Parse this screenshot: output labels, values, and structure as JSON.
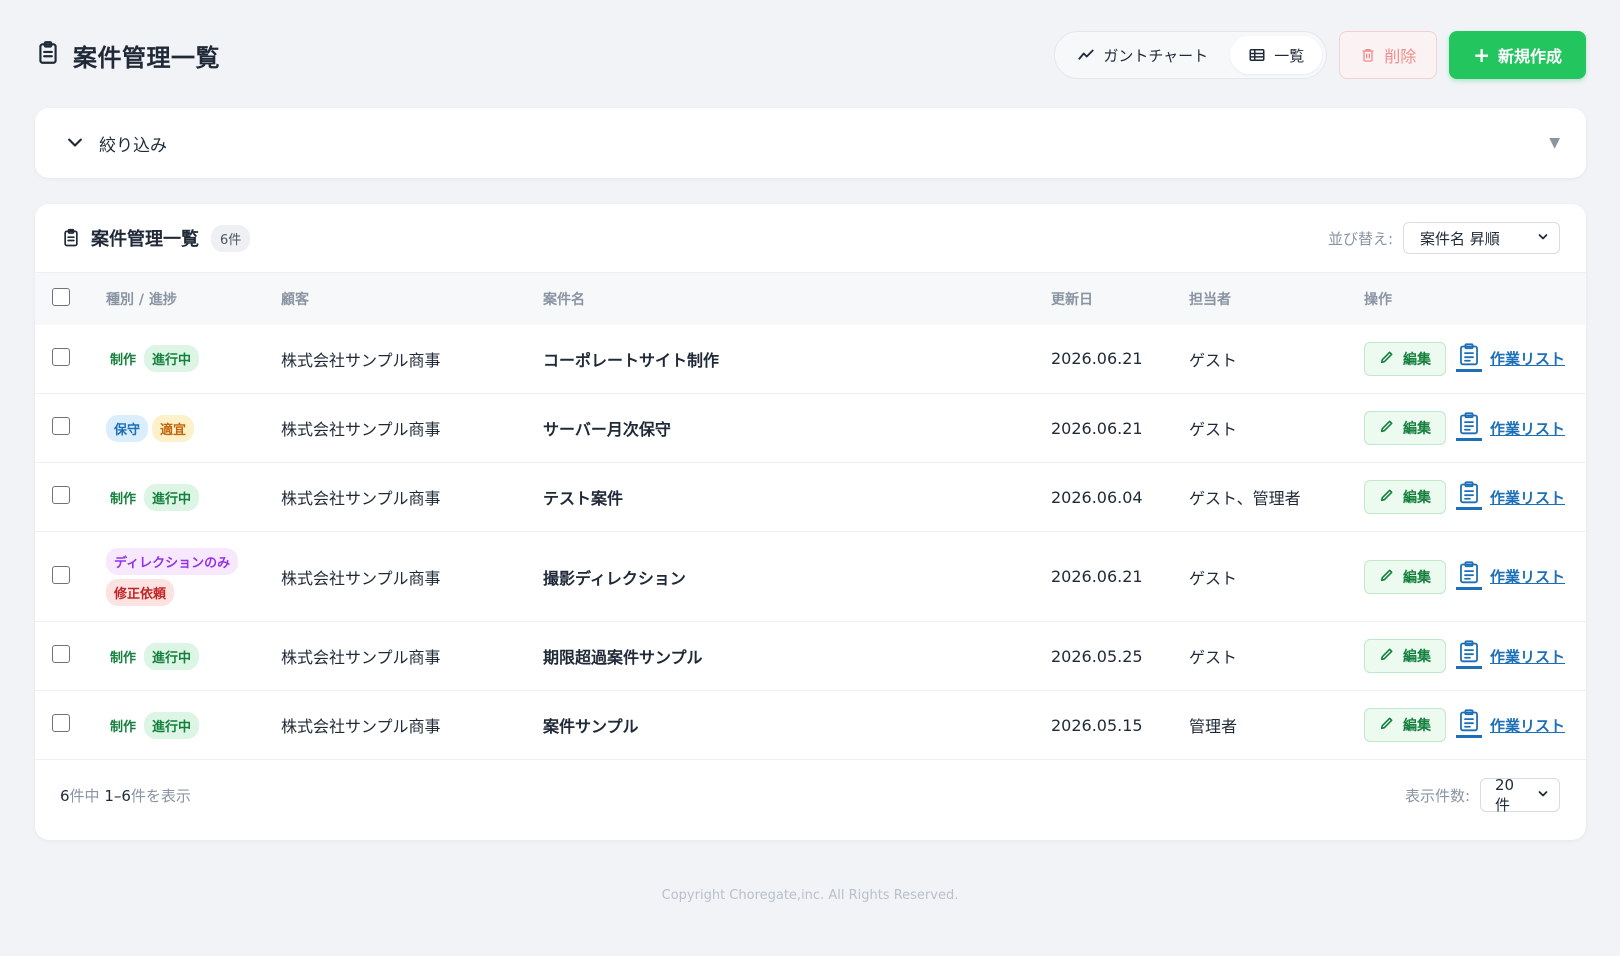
{
  "header": {
    "title": "案件管理一覧",
    "views": [
      {
        "label": "ガントチャート",
        "active": false
      },
      {
        "label": "一覧",
        "active": true
      }
    ],
    "delete_label": "削除",
    "new_label": "新規作成"
  },
  "filter": {
    "label": "絞り込み",
    "caret": "▼"
  },
  "list": {
    "title": "案件管理一覧",
    "count": "6件",
    "sort_label": "並び替え:",
    "sort_value": "案件名 昇順",
    "columns": {
      "type": "種別 / 進捗",
      "client": "顧客",
      "name": "案件名",
      "date": "更新日",
      "owner": "担当者",
      "actions": "操作"
    },
    "rows": [
      {
        "badges": [
          {
            "text": "制作",
            "style": "green plain"
          },
          {
            "text": "進行中",
            "style": "green"
          }
        ],
        "client": "株式会社サンプル商事",
        "name": "コーポレートサイト制作",
        "date": "2026.06.21",
        "owner": "ゲスト",
        "edit": "編集",
        "tasks": "作業リスト"
      },
      {
        "badges": [
          {
            "text": "保守",
            "style": "blue"
          },
          {
            "text": "適宜",
            "style": "orange"
          }
        ],
        "client": "株式会社サンプル商事",
        "name": "サーバー月次保守",
        "date": "2026.06.21",
        "owner": "ゲスト",
        "edit": "編集",
        "tasks": "作業リスト"
      },
      {
        "badges": [
          {
            "text": "制作",
            "style": "green plain"
          },
          {
            "text": "進行中",
            "style": "green"
          }
        ],
        "client": "株式会社サンプル商事",
        "name": "テスト案件",
        "date": "2026.06.04",
        "owner": "ゲスト、管理者",
        "edit": "編集",
        "tasks": "作業リスト"
      },
      {
        "badges": [
          {
            "text": "ディレクションのみ",
            "style": "purple"
          },
          {
            "text": "修正依頼",
            "style": "red"
          }
        ],
        "client": "株式会社サンプル商事",
        "name": "撮影ディレクション",
        "date": "2026.06.21",
        "owner": "ゲスト",
        "edit": "編集",
        "tasks": "作業リスト"
      },
      {
        "badges": [
          {
            "text": "制作",
            "style": "green plain"
          },
          {
            "text": "進行中",
            "style": "green"
          }
        ],
        "client": "株式会社サンプル商事",
        "name": "期限超過案件サンプル",
        "date": "2026.05.25",
        "owner": "ゲスト",
        "edit": "編集",
        "tasks": "作業リスト"
      },
      {
        "badges": [
          {
            "text": "制作",
            "style": "green plain"
          },
          {
            "text": "進行中",
            "style": "green"
          }
        ],
        "client": "株式会社サンプル商事",
        "name": "案件サンプル",
        "date": "2026.05.15",
        "owner": "管理者",
        "edit": "編集",
        "tasks": "作業リスト"
      }
    ],
    "footer": {
      "total": "6",
      "range_mid": "件中 ",
      "range": "1–6",
      "range_end": "件を表示",
      "per_page_label": "表示件数:",
      "per_page_value": "20件"
    }
  },
  "copyright": "Copyright Choregate,inc. All Rights Reserved.",
  "colors": {
    "primary": "#22c55e",
    "link": "#1d6fb8",
    "danger_soft": "#f08d8d",
    "background": "#f1f3f6"
  }
}
